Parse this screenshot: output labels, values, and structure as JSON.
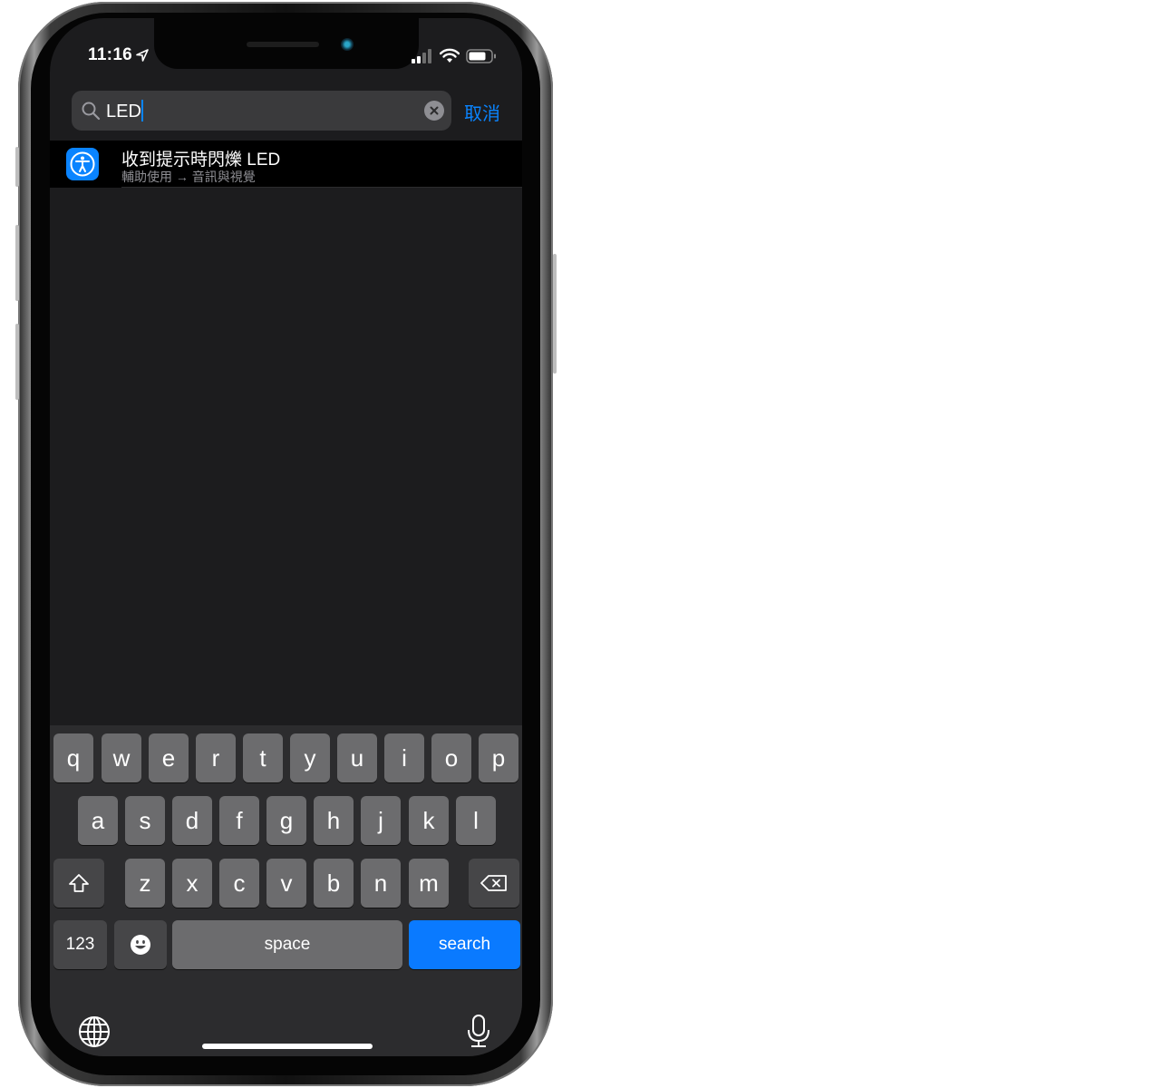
{
  "status_bar": {
    "time": "11:16",
    "icons": [
      "location-arrow-icon",
      "cellular-signal-icon",
      "wifi-icon",
      "battery-icon"
    ]
  },
  "search": {
    "value": "LED",
    "placeholder": "",
    "clear_icon": "clear-x-icon",
    "search_icon": "magnifier-icon",
    "cancel_label": "取消"
  },
  "results": [
    {
      "icon": "accessibility-icon",
      "title": "收到提示時閃爍 LED",
      "path": "輔助使用 → 音訊與視覺"
    }
  ],
  "keyboard": {
    "row1": [
      "q",
      "w",
      "e",
      "r",
      "t",
      "y",
      "u",
      "i",
      "o",
      "p"
    ],
    "row2": [
      "a",
      "s",
      "d",
      "f",
      "g",
      "h",
      "j",
      "k",
      "l"
    ],
    "row3": [
      "z",
      "x",
      "c",
      "v",
      "b",
      "n",
      "m"
    ],
    "numbers_label": "123",
    "space_label": "space",
    "return_label": "search",
    "icons": [
      "shift-icon",
      "delete-icon",
      "emoji-icon",
      "globe-icon",
      "microphone-icon"
    ]
  },
  "colors": {
    "accent": "#0a84ff",
    "screen_bg": "#1c1c1e",
    "result_bg": "#000000",
    "key_bg": "#6c6c6e",
    "key_dark_bg": "#464648",
    "keyboard_bg": "#2c2c2e"
  }
}
